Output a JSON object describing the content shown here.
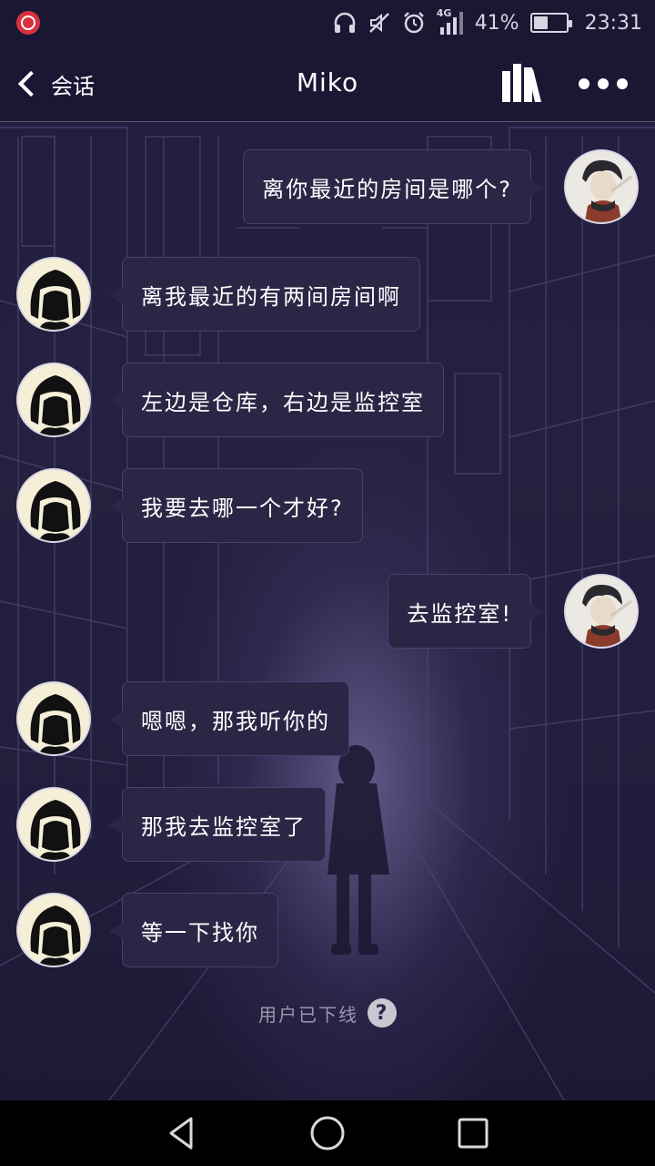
{
  "status_bar": {
    "battery_percent": "41%",
    "battery_level": 0.41,
    "network": "4G",
    "time": "23:31",
    "icons": [
      "app-notification-icon",
      "headphones-icon",
      "mute-icon",
      "alarm-icon",
      "signal-icon",
      "battery-icon"
    ]
  },
  "header": {
    "back_label": "会话",
    "title": "Miko",
    "icons": [
      "chevron-left-icon",
      "books-icon",
      "more-icon"
    ]
  },
  "messages": [
    {
      "side": "outgoing",
      "text": "离你最近的房间是哪个?"
    },
    {
      "side": "incoming",
      "text": "离我最近的有两间房间啊"
    },
    {
      "side": "incoming",
      "text": "左边是仓库，右边是监控室"
    },
    {
      "side": "incoming",
      "text": "我要去哪一个才好?"
    },
    {
      "side": "outgoing",
      "text": "去监控室!"
    },
    {
      "side": "incoming",
      "text": "嗯嗯，那我听你的"
    },
    {
      "side": "incoming",
      "text": "那我去监控室了"
    },
    {
      "side": "incoming",
      "text": "等一下找你"
    }
  ],
  "offline_note": "用户已下线",
  "offline_help": "?",
  "nav_bar": {
    "icons": [
      "back-triangle-icon",
      "home-circle-icon",
      "recents-square-icon"
    ]
  },
  "colors": {
    "background": "#221e40",
    "bubble": "#2a2746",
    "bubble_border": "#46426a",
    "header_border": "#5d5a75",
    "muted_text": "#9a98ad"
  }
}
